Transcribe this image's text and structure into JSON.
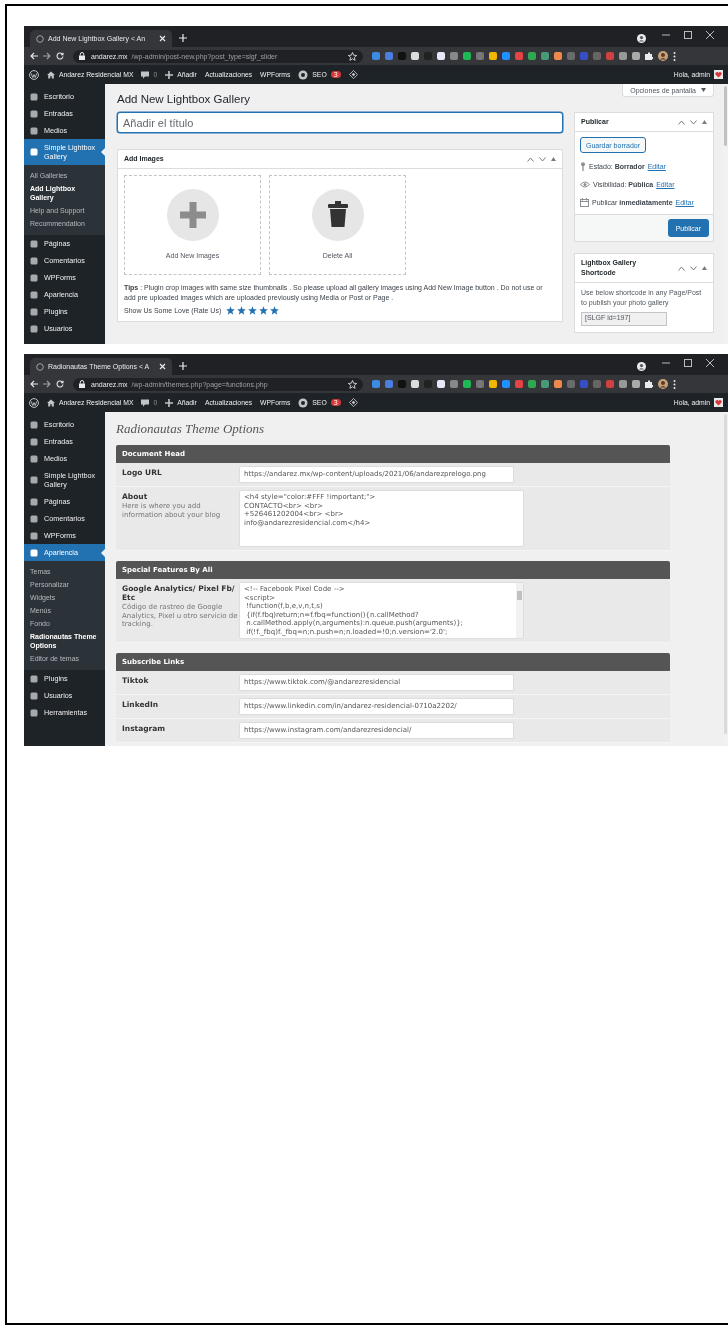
{
  "windows": [
    {
      "kind": "gallery_editor",
      "tab_title": "Add New Lightbox Gallery < An",
      "url_host": "andarez.mx",
      "url_path": "/wp-admin/post-new.php?post_type=slgf_slider",
      "admin_bar": {
        "site": "Andarez Residencial MX",
        "comments": "0",
        "add": "Añadir",
        "links": [
          "Actualizaciones",
          "WPForms"
        ],
        "seo": "SEO",
        "seo_count": "3",
        "greeting": "Hola, admin"
      },
      "sidebar": [
        {
          "label": "Escritorio",
          "selected": false
        },
        {
          "label": "Entradas",
          "selected": false
        },
        {
          "label": "Medios",
          "selected": false
        },
        {
          "label": "Simple Lightbox Gallery",
          "selected": true,
          "children": [
            {
              "label": "All Galleries",
              "selected": false
            },
            {
              "label": "Add Lightbox Gallery",
              "selected": true
            },
            {
              "label": "Help and Support",
              "selected": false
            },
            {
              "label": "Recommendation",
              "selected": false
            }
          ]
        },
        {
          "label": "Páginas",
          "selected": false
        },
        {
          "label": "Comentarios",
          "selected": false
        },
        {
          "label": "WPForms",
          "selected": false
        },
        {
          "label": "Apariencia",
          "selected": false
        },
        {
          "label": "Plugins",
          "selected": false
        },
        {
          "label": "Usuarios",
          "selected": false
        }
      ],
      "screen_options": "Opciones de pantalla",
      "page_title": "Add New Lightbox Gallery",
      "title_placeholder": "Añadir el título",
      "images_box": {
        "title": "Add Images",
        "tiles": [
          {
            "kind": "add",
            "label": "Add New Images"
          },
          {
            "kind": "delete",
            "label": "Delete All"
          }
        ],
        "tips": "**Tips** : Plugin crop images with same size thumbnails . So please upload all gallery images using Add New Image button . Do not use or add pre uploaded images which are uploaded previously using Media or Post or Page .",
        "rate_label": "Show Us Some Love (Rate Us)",
        "stars": 5
      },
      "publish_box": {
        "title": "Publicar",
        "save_draft": "Guardar borrador",
        "rows": [
          {
            "kind": "status",
            "text": "Estado: **Borrador**",
            "link": "Editar"
          },
          {
            "kind": "visibility",
            "text": "Visibilidad: **Pública**",
            "link": "Editar"
          },
          {
            "kind": "schedule",
            "text": "Publicar **inmediatamente**",
            "link": "Editar"
          }
        ],
        "publish_button": "Publicar"
      },
      "shortcode_box": {
        "title": "Lightbox Gallery Shortcode",
        "text": "Use below shortcode in any Page/Post to publish your photo gallery",
        "value": "[SLGF id=197]"
      }
    },
    {
      "kind": "theme_options",
      "tab_title": "Radionautas Theme Options < A",
      "url_host": "andarez.mx",
      "url_path": "/wp-admin/themes.php?page=functions.php",
      "admin_bar": {
        "site": "Andarez Residencial MX",
        "comments": "0",
        "add": "Añadir",
        "links": [
          "Actualizaciones",
          "WPForms"
        ],
        "seo": "SEO",
        "seo_count": "3",
        "greeting": "Hola, admin"
      },
      "sidebar": [
        {
          "label": "Escritorio",
          "selected": false
        },
        {
          "label": "Entradas",
          "selected": false
        },
        {
          "label": "Medios",
          "selected": false
        },
        {
          "label": "Simple Lightbox Gallery",
          "selected": false
        },
        {
          "label": "Páginas",
          "selected": false
        },
        {
          "label": "Comentarios",
          "selected": false
        },
        {
          "label": "WPForms",
          "selected": false
        },
        {
          "label": "Apariencia",
          "selected": true,
          "children": [
            {
              "label": "Temas",
              "selected": false
            },
            {
              "label": "Personalizar",
              "selected": false
            },
            {
              "label": "Widgets",
              "selected": false
            },
            {
              "label": "Menús",
              "selected": false
            },
            {
              "label": "Fondo",
              "selected": false
            },
            {
              "label": "Radionautas Theme Options",
              "selected": true
            },
            {
              "label": "Editor de temas",
              "selected": false
            }
          ]
        },
        {
          "label": "Plugins",
          "selected": false
        },
        {
          "label": "Usuarios",
          "selected": false
        },
        {
          "label": "Herramientas",
          "selected": false
        }
      ],
      "page_title": "Radionautas Theme Options",
      "sections": [
        {
          "title": "Document Head",
          "fields": [
            {
              "kind": "input",
              "label": "Logo URL",
              "value": "https://andarez.mx/wp-content/uploads/2021/06/andarezprelogo.png"
            },
            {
              "kind": "textarea",
              "label": "About",
              "description": "Here is where you add information about your blog",
              "lines": [
                "<h4 style=\"color:#FFF !important;\">",
                "CONTACTO<br> <br>",
                "+526461202004<br> <br>",
                "info@andarezresidencial.com</h4>"
              ]
            }
          ]
        },
        {
          "title": "Special Features By Ali",
          "fields": [
            {
              "kind": "code",
              "label": "Google Analytics/ Pixel Fb/ Etc",
              "description": "Código de rastreo de Google Analytics, Pixel u otro servicio de tracking.",
              "lines": [
                "<!-- Facebook Pixel Code -->",
                "<script>",
                " !function(f,b,e,v,n,t,s)",
                " {if(f.fbq)return;n=f.fbq=function(){n.callMethod?",
                " n.callMethod.apply(n,arguments):n.queue.push(arguments)};",
                " if(!f._fbq)f._fbq=n;n.push=n;n.loaded=!0;n.version='2.0';"
              ]
            }
          ]
        },
        {
          "title": "Subscribe Links",
          "fields": [
            {
              "kind": "input",
              "label": "Tiktok",
              "value": "https://www.tiktok.com/@andarezresidencial"
            },
            {
              "kind": "input",
              "label": "LinkedIn",
              "value": "https://www.linkedin.com/in/andarez-residencial-0710a2202/"
            },
            {
              "kind": "input",
              "label": "Instagram",
              "value": "https://www.instagram.com/andarezresidencial/"
            }
          ]
        }
      ]
    }
  ]
}
